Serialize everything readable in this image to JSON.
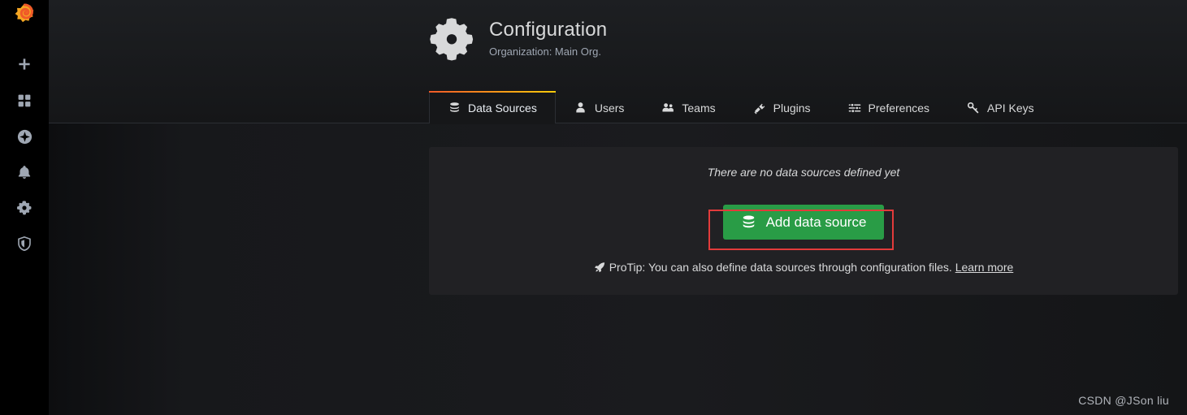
{
  "sidebar": {
    "logo": {
      "name": "grafana-logo",
      "color": "#f05a28"
    },
    "items": [
      {
        "icon": "plus-icon",
        "label": "Create"
      },
      {
        "icon": "dashboards-icon",
        "label": "Dashboards"
      },
      {
        "icon": "compass-icon",
        "label": "Explore"
      },
      {
        "icon": "bell-icon",
        "label": "Alerting"
      },
      {
        "icon": "gear-icon",
        "label": "Configuration"
      },
      {
        "icon": "shield-icon",
        "label": "Server Admin"
      }
    ]
  },
  "header": {
    "icon": "gear-icon",
    "title": "Configuration",
    "subtitle": "Organization: Main Org."
  },
  "tabs": [
    {
      "label": "Data Sources",
      "icon": "database-icon",
      "active": true
    },
    {
      "label": "Users",
      "icon": "user-icon",
      "active": false
    },
    {
      "label": "Teams",
      "icon": "users-icon",
      "active": false
    },
    {
      "label": "Plugins",
      "icon": "plug-icon",
      "active": false
    },
    {
      "label": "Preferences",
      "icon": "sliders-icon",
      "active": false
    },
    {
      "label": "API Keys",
      "icon": "key-icon",
      "active": false
    }
  ],
  "panel": {
    "empty_message": "There are no data sources defined yet",
    "add_button": {
      "label": "Add data source",
      "icon": "database-icon",
      "color": "#299c46"
    },
    "protip": {
      "icon": "rocket-icon",
      "text": "ProTip: You can also define data sources through configuration files.",
      "link_label": "Learn more"
    }
  },
  "annotation": {
    "name": "red-highlight-box",
    "color": "#e23b3b"
  },
  "watermark": {
    "text": "CSDN @JSon  liu"
  }
}
